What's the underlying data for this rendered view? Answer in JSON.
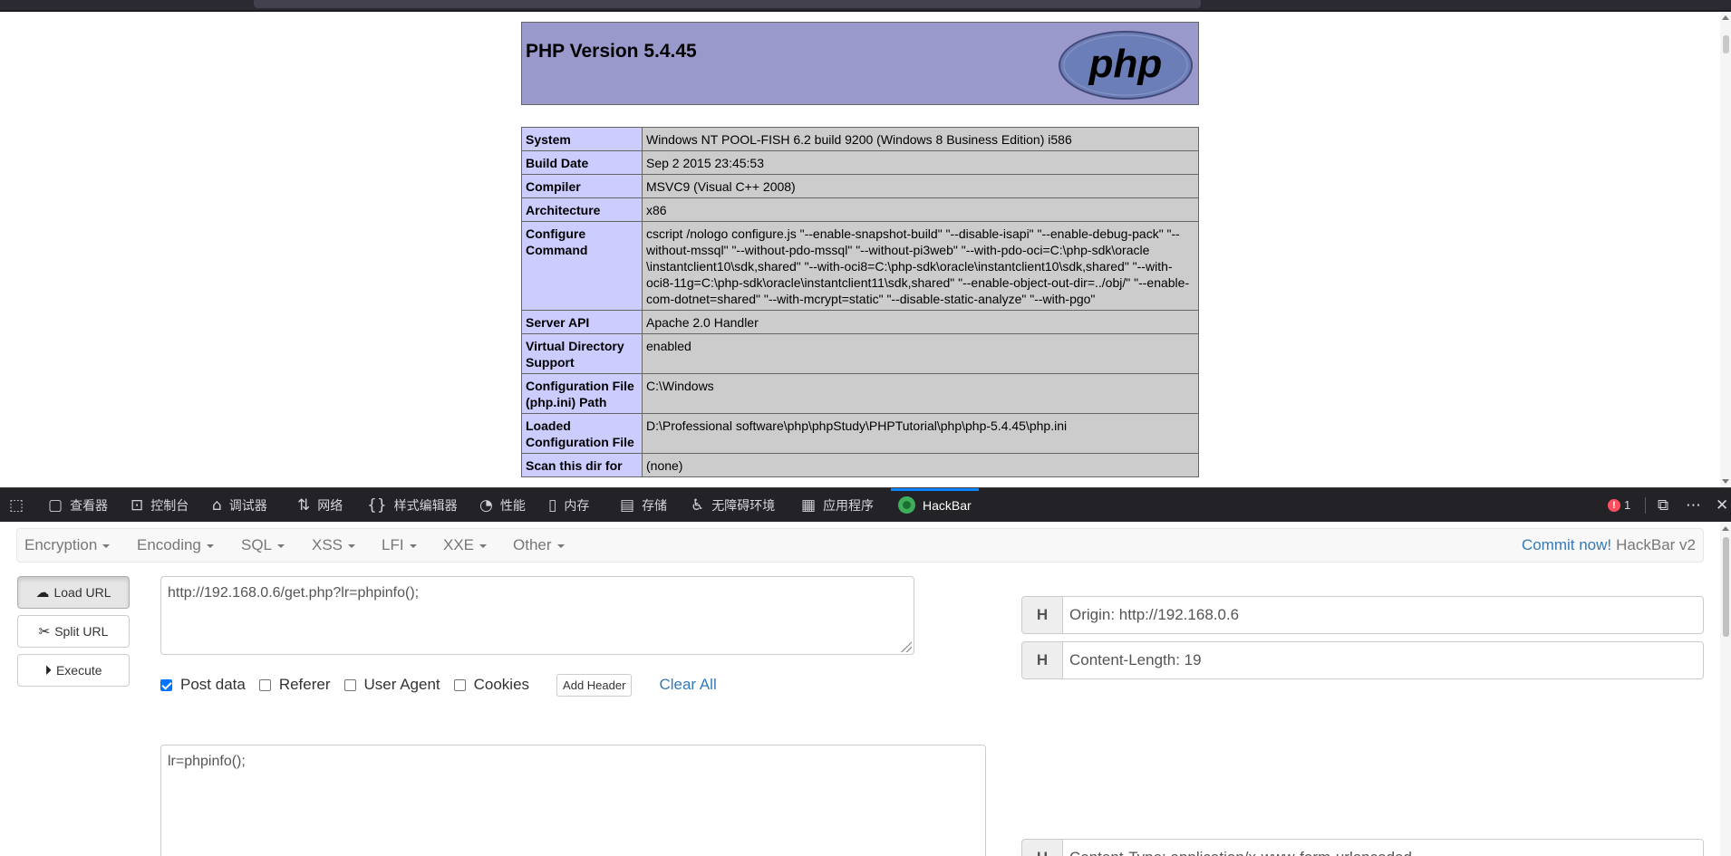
{
  "php_page": {
    "version_title": "PHP Version 5.4.45",
    "logo_text": "php",
    "rows": [
      {
        "label": "System",
        "value": "Windows NT POOL-FISH 6.2 build 9200 (Windows 8 Business Edition) i586"
      },
      {
        "label": "Build Date",
        "value": "Sep 2 2015 23:45:53"
      },
      {
        "label": "Compiler",
        "value": "MSVC9 (Visual C++ 2008)"
      },
      {
        "label": "Architecture",
        "value": "x86"
      },
      {
        "label": "Configure Command",
        "value": "cscript /nologo configure.js \"--enable-snapshot-build\" \"--disable-isapi\" \"--enable-debug-pack\" \"--without-mssql\" \"--without-pdo-mssql\" \"--without-pi3web\" \"--with-pdo-oci=C:\\php-sdk\\oracle \\instantclient10\\sdk,shared\" \"--with-oci8=C:\\php-sdk\\oracle\\instantclient10\\sdk,shared\" \"--with-oci8-11g=C:\\php-sdk\\oracle\\instantclient11\\sdk,shared\" \"--enable-object-out-dir=../obj/\" \"--enable-com-dotnet=shared\" \"--with-mcrypt=static\" \"--disable-static-analyze\" \"--with-pgo\""
      },
      {
        "label": "Server API",
        "value": "Apache 2.0 Handler"
      },
      {
        "label": "Virtual Directory Support",
        "value": "enabled"
      },
      {
        "label": "Configuration File (php.ini) Path",
        "value": "C:\\Windows"
      },
      {
        "label": "Loaded Configuration File",
        "value": "D:\\Professional software\\php\\phpStudy\\PHPTutorial\\php\\php-5.4.45\\php.ini"
      },
      {
        "label": "Scan this dir for",
        "value": "(none)"
      }
    ]
  },
  "devtools": {
    "tabs": [
      {
        "label": "查看器",
        "icon": "inspector-icon"
      },
      {
        "label": "控制台",
        "icon": "console-icon"
      },
      {
        "label": "调试器",
        "icon": "debugger-icon"
      },
      {
        "label": "网络",
        "icon": "network-icon"
      },
      {
        "label": "样式编辑器",
        "icon": "style-editor-icon"
      },
      {
        "label": "性能",
        "icon": "performance-icon"
      },
      {
        "label": "内存",
        "icon": "memory-icon"
      },
      {
        "label": "存储",
        "icon": "storage-icon"
      },
      {
        "label": "无障碍环境",
        "icon": "accessibility-icon"
      },
      {
        "label": "应用程序",
        "icon": "application-icon"
      },
      {
        "label": "HackBar",
        "icon": "hackbar-icon"
      }
    ],
    "active_tab": "HackBar",
    "error_count": "1",
    "colors": {
      "toolbar_bg": "#232327",
      "active_indicator": "#0a84ff",
      "error": "#ff4f5e"
    }
  },
  "hackbar": {
    "menu": [
      "Encryption",
      "Encoding",
      "SQL",
      "XSS",
      "LFI",
      "XXE",
      "Other"
    ],
    "commit_link": "Commit now!",
    "version": "HackBar v2",
    "buttons": {
      "load_url": "Load URL",
      "split_url": "Split URL",
      "execute": "Execute"
    },
    "url_value": "http://192.168.0.6/get.php?lr=phpinfo();",
    "options": {
      "post_data": {
        "label": "Post data",
        "checked": true
      },
      "referer": {
        "label": "Referer",
        "checked": false
      },
      "user_agent": {
        "label": "User Agent",
        "checked": false
      },
      "cookies": {
        "label": "Cookies",
        "checked": false
      }
    },
    "add_header": "Add Header",
    "clear_all": "Clear All",
    "post_body": "lr=phpinfo();",
    "header_addon": "H",
    "headers": [
      "Origin: http://192.168.0.6",
      "Content-Length: 19",
      "Content-Type: application/x-www-form-urlencoded"
    ],
    "colors": {
      "link": "#337ab7",
      "checkbox": "#0075ff"
    }
  }
}
